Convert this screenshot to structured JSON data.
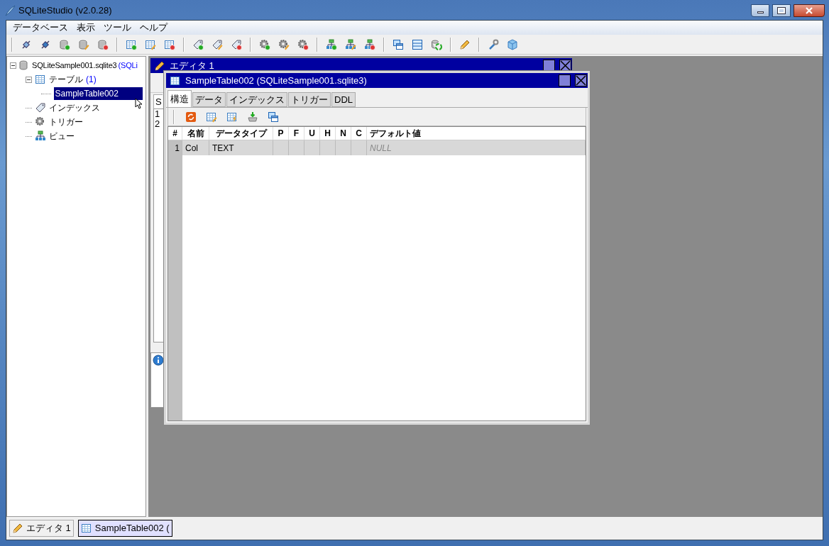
{
  "window": {
    "title": "SQLiteStudio (v2.0.28)"
  },
  "menu": [
    "データベース",
    "表示",
    "ツール",
    "ヘルプ"
  ],
  "tree": {
    "label": "SQLiteSample001.sqlite3",
    "suffix": "(SQLi",
    "expanded": true,
    "children": [
      {
        "label": "テーブル",
        "count": "(1)",
        "kind": "table",
        "expanded": true,
        "children": [
          {
            "label": "SampleTable002",
            "selected": true
          }
        ]
      },
      {
        "label": "インデックス",
        "kind": "index"
      },
      {
        "label": "トリガー",
        "kind": "trigger"
      },
      {
        "label": "ビュー",
        "kind": "view"
      }
    ]
  },
  "editor_window": {
    "title": "エディタ 1",
    "tab": "S",
    "line_numbers": [
      "1",
      "2"
    ]
  },
  "table_window": {
    "title": "SampleTable002 (SQLiteSample001.sqlite3)",
    "tabs": [
      {
        "label": "構造",
        "selected": true
      },
      {
        "label": "データ",
        "selected": false
      },
      {
        "label": "インデックス",
        "selected": false
      },
      {
        "label": "トリガー",
        "selected": false
      },
      {
        "label": "DDL",
        "selected": false
      }
    ],
    "columns": [
      "#",
      "名前",
      "データタイプ",
      "P",
      "F",
      "U",
      "H",
      "N",
      "C",
      "デフォルト値"
    ],
    "rows": [
      {
        "selected": true,
        "cells": [
          "1",
          "Col",
          "TEXT",
          "",
          "",
          "",
          "",
          "",
          "",
          ""
        ],
        "default_placeholder": "NULL"
      }
    ]
  },
  "taskbar": [
    {
      "label": "エディタ 1",
      "kind": "editor",
      "selected": false
    },
    {
      "label": "SampleTable002 (",
      "kind": "table",
      "selected": true
    }
  ]
}
